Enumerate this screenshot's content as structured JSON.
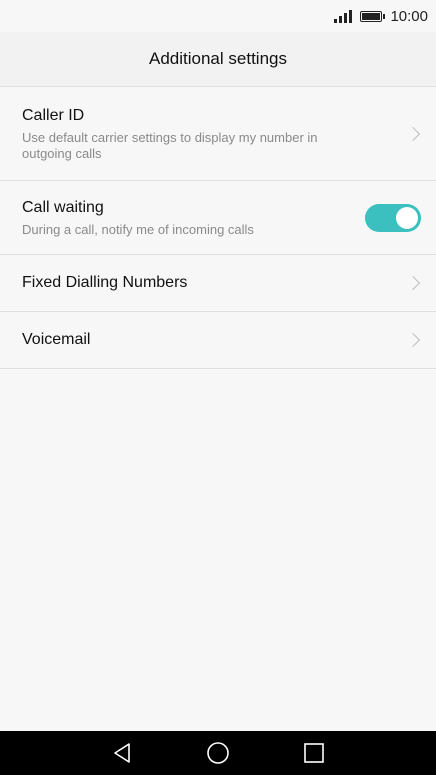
{
  "status_bar": {
    "time": "10:00",
    "icons": [
      "signal-icon",
      "battery-icon"
    ]
  },
  "header": {
    "title": "Additional settings"
  },
  "settings": {
    "items": [
      {
        "title": "Caller ID",
        "subtitle": "Use default carrier settings to display my number in outgoing calls",
        "control": "chevron"
      },
      {
        "title": "Call waiting",
        "subtitle": "During a call, notify me of incoming calls",
        "control": "toggle",
        "toggle_on": true
      },
      {
        "title": "Fixed Dialling Numbers",
        "control": "chevron"
      },
      {
        "title": "Voicemail",
        "control": "chevron"
      }
    ]
  },
  "nav_bar": {
    "buttons": [
      "back-icon",
      "home-icon",
      "recents-icon"
    ]
  },
  "colors": {
    "toggle_accent": "#3cbfbf",
    "background": "#f7f7f7",
    "nav_bar": "#000000"
  }
}
